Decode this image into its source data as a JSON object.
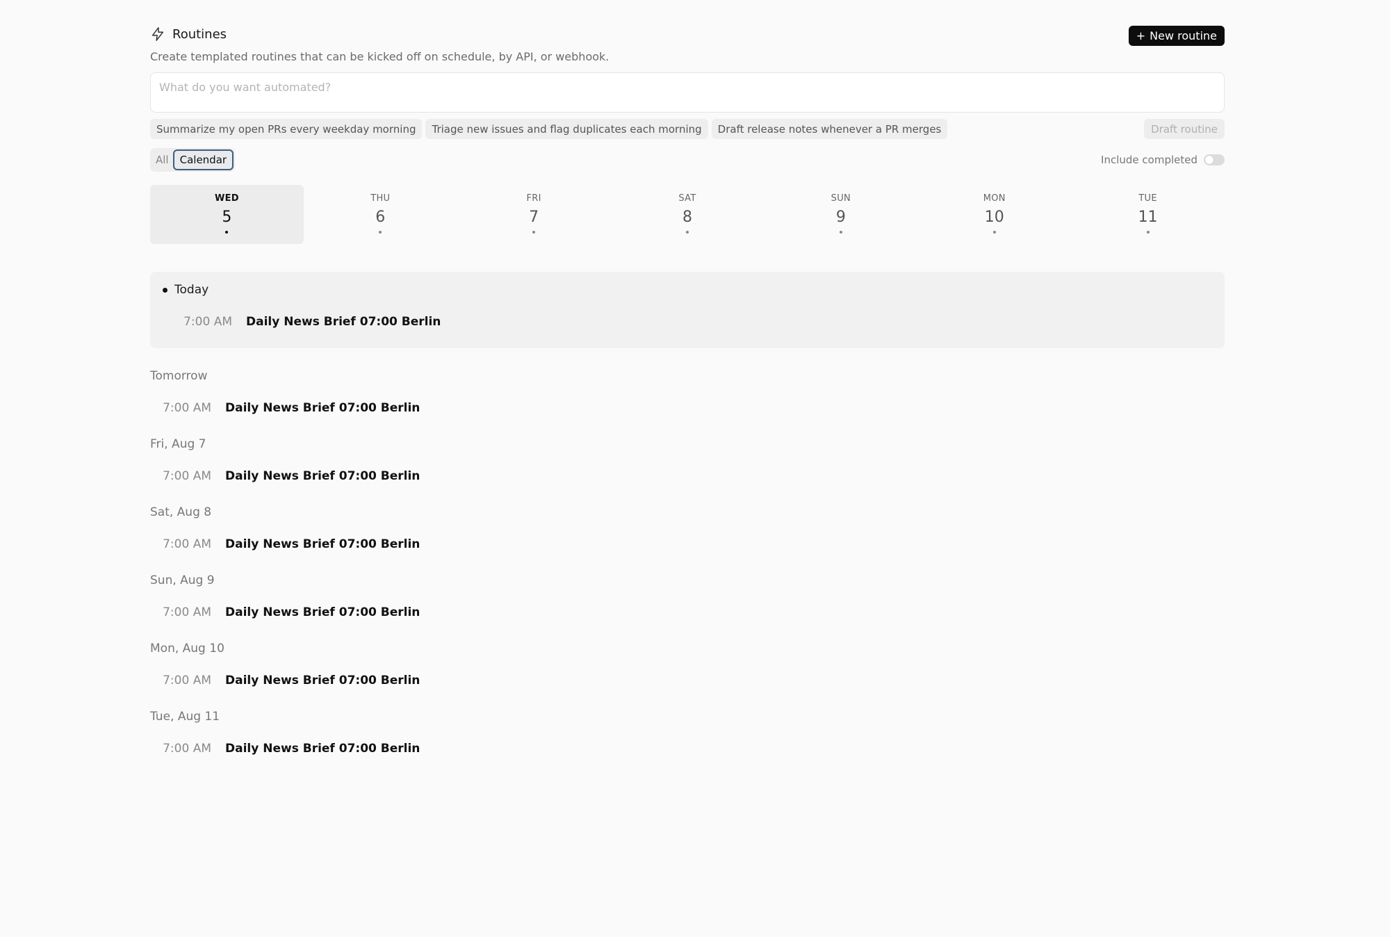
{
  "header": {
    "title": "Routines",
    "subtitle": "Create templated routines that can be kicked off on schedule, by API, or webhook.",
    "new_button_icon": "+",
    "new_button_label": "New routine"
  },
  "prompt": {
    "placeholder": "What do you want automated?",
    "value": ""
  },
  "suggestions": [
    "Summarize my open PRs every weekday morning",
    "Triage new issues and flag duplicates each morning",
    "Draft release notes whenever a PR merges"
  ],
  "draft_button_label": "Draft routine",
  "view_tabs": {
    "all_label": "All",
    "calendar_label": "Calendar",
    "selected": "Calendar"
  },
  "include_completed": {
    "label": "Include completed",
    "on": false
  },
  "week": [
    {
      "dow": "WED",
      "num": "5",
      "selected": true
    },
    {
      "dow": "THU",
      "num": "6",
      "selected": false
    },
    {
      "dow": "FRI",
      "num": "7",
      "selected": false
    },
    {
      "dow": "SAT",
      "num": "8",
      "selected": false
    },
    {
      "dow": "SUN",
      "num": "9",
      "selected": false
    },
    {
      "dow": "MON",
      "num": "10",
      "selected": false
    },
    {
      "dow": "TUE",
      "num": "11",
      "selected": false
    }
  ],
  "today": {
    "label": "Today",
    "entries": [
      {
        "time": "7:00 AM",
        "name": "Daily News Brief 07:00 Berlin"
      }
    ]
  },
  "groups": [
    {
      "title": "Tomorrow",
      "entries": [
        {
          "time": "7:00 AM",
          "name": "Daily News Brief 07:00 Berlin"
        }
      ]
    },
    {
      "title": "Fri, Aug 7",
      "entries": [
        {
          "time": "7:00 AM",
          "name": "Daily News Brief 07:00 Berlin"
        }
      ]
    },
    {
      "title": "Sat, Aug 8",
      "entries": [
        {
          "time": "7:00 AM",
          "name": "Daily News Brief 07:00 Berlin"
        }
      ]
    },
    {
      "title": "Sun, Aug 9",
      "entries": [
        {
          "time": "7:00 AM",
          "name": "Daily News Brief 07:00 Berlin"
        }
      ]
    },
    {
      "title": "Mon, Aug 10",
      "entries": [
        {
          "time": "7:00 AM",
          "name": "Daily News Brief 07:00 Berlin"
        }
      ]
    },
    {
      "title": "Tue, Aug 11",
      "entries": [
        {
          "time": "7:00 AM",
          "name": "Daily News Brief 07:00 Berlin"
        }
      ]
    }
  ],
  "icons": {
    "title_icon": "lightning-bolt-icon"
  }
}
